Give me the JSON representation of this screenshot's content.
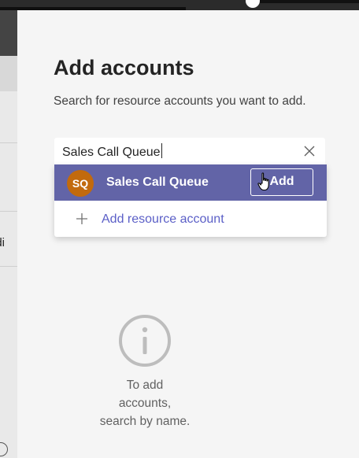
{
  "dialog": {
    "title": "Add accounts",
    "subtitle": "Search for resource accounts you want to add."
  },
  "search": {
    "value": "Sales Call Queue",
    "clear_icon": "close-icon"
  },
  "results": [
    {
      "initials": "SQ",
      "name": "Sales Call Queue",
      "add_label": "Add",
      "avatar_color": "#c26a0d",
      "highlight_color": "#6264a7"
    }
  ],
  "add_resource": {
    "label": "Add resource account",
    "icon": "plus-icon",
    "color": "#5b5fc7"
  },
  "empty_state": {
    "icon": "info-icon",
    "line1": "To add",
    "line2": "accounts,",
    "line3": "search by name."
  },
  "background": {
    "clipped_text": "ddi"
  }
}
